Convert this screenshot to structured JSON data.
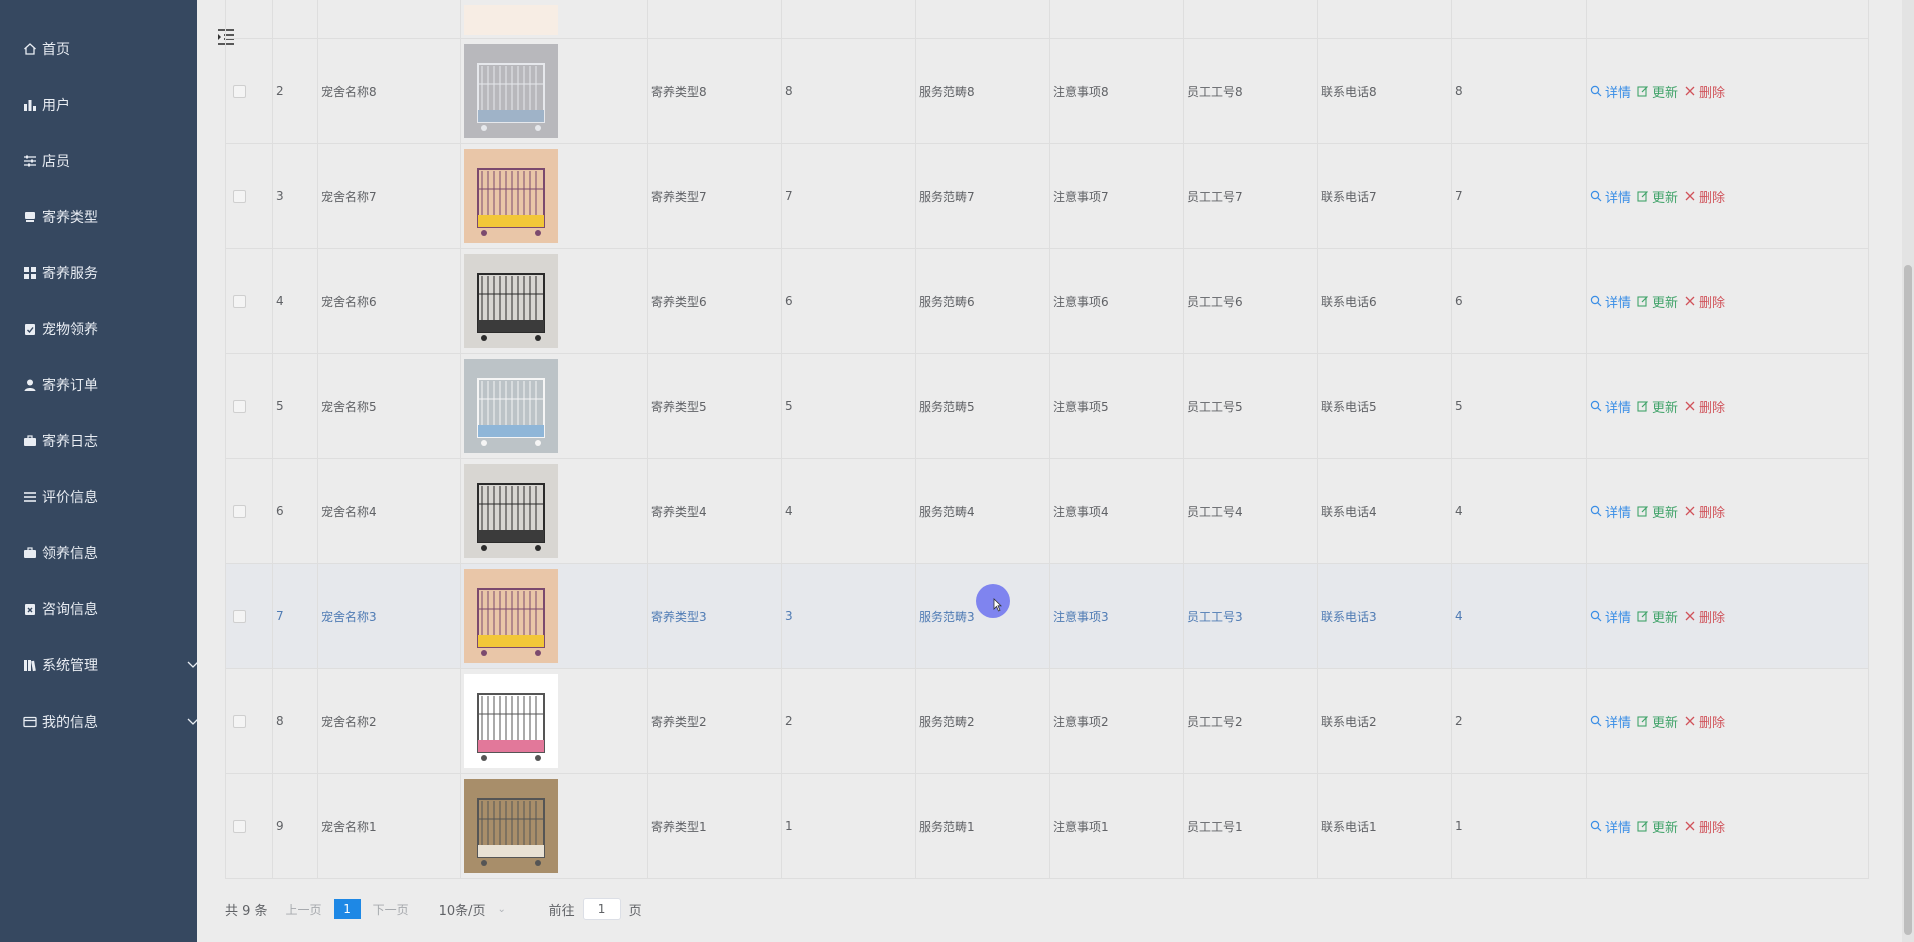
{
  "sidebar": {
    "items": [
      {
        "label": "首页",
        "icon": "home-icon"
      },
      {
        "label": "用户",
        "icon": "bar-chart-icon"
      },
      {
        "label": "店员",
        "icon": "sliders-icon"
      },
      {
        "label": "寄养类型",
        "icon": "box-icon"
      },
      {
        "label": "寄养服务",
        "icon": "grid-icon"
      },
      {
        "label": "宠物领养",
        "icon": "clipboard-check-icon"
      },
      {
        "label": "寄养订单",
        "icon": "user-icon"
      },
      {
        "label": "寄养日志",
        "icon": "briefcase-icon"
      },
      {
        "label": "评价信息",
        "icon": "list-icon"
      },
      {
        "label": "领养信息",
        "icon": "briefcase-icon"
      },
      {
        "label": "咨询信息",
        "icon": "clipboard-x-icon"
      },
      {
        "label": "系统管理",
        "icon": "library-icon",
        "expandable": true
      },
      {
        "label": "我的信息",
        "icon": "card-icon",
        "expandable": true
      }
    ]
  },
  "table": {
    "rows": [
      {
        "index": "2",
        "name": "宠舍名称8",
        "type": "寄养类型8",
        "num": "8",
        "scope": "服务范畴8",
        "notes": "注意事项8",
        "staff": "员工工号8",
        "phone": "联系电话8",
        "last": "8",
        "image": "cage-white-icon",
        "highlight": false
      },
      {
        "index": "3",
        "name": "宠舍名称7",
        "type": "寄养类型7",
        "num": "7",
        "scope": "服务范畴7",
        "notes": "注意事项7",
        "staff": "员工工号7",
        "phone": "联系电话7",
        "last": "7",
        "image": "cage-hamster-icon",
        "highlight": false
      },
      {
        "index": "4",
        "name": "宠舍名称6",
        "type": "寄养类型6",
        "num": "6",
        "scope": "服务范畴6",
        "notes": "注意事项6",
        "staff": "员工工号6",
        "phone": "联系电话6",
        "last": "6",
        "image": "cage-black-icon",
        "highlight": false
      },
      {
        "index": "5",
        "name": "宠舍名称5",
        "type": "寄养类型5",
        "num": "5",
        "scope": "服务范畴5",
        "notes": "注意事项5",
        "staff": "员工工号5",
        "phone": "联系电话5",
        "last": "5",
        "image": "cage-dog-icon",
        "highlight": false
      },
      {
        "index": "6",
        "name": "宠舍名称4",
        "type": "寄养类型4",
        "num": "4",
        "scope": "服务范畴4",
        "notes": "注意事项4",
        "staff": "员工工号4",
        "phone": "联系电话4",
        "last": "4",
        "image": "cage-black-icon",
        "highlight": false
      },
      {
        "index": "7",
        "name": "宠舍名称3",
        "type": "寄养类型3",
        "num": "3",
        "scope": "服务范畴3",
        "notes": "注意事项3",
        "staff": "员工工号3",
        "phone": "联系电话3",
        "last": "4",
        "image": "cage-hamster-icon",
        "highlight": true
      },
      {
        "index": "8",
        "name": "宠舍名称2",
        "type": "寄养类型2",
        "num": "2",
        "scope": "服务范畴2",
        "notes": "注意事项2",
        "staff": "员工工号2",
        "phone": "联系电话2",
        "last": "2",
        "image": "cage-pink-icon",
        "highlight": false
      },
      {
        "index": "9",
        "name": "宠舍名称1",
        "type": "寄养类型1",
        "num": "1",
        "scope": "服务范畴1",
        "notes": "注意事项1",
        "staff": "员工工号1",
        "phone": "联系电话1",
        "last": "1",
        "image": "cage-cabinet-icon",
        "highlight": false
      }
    ],
    "actions": {
      "detail": "详情",
      "update": "更新",
      "delete": "删除"
    }
  },
  "pagination": {
    "total": "共 9 条",
    "prev": "上一页",
    "current": "1",
    "next": "下一页",
    "page_size": "10条/页",
    "goto_label": "前往",
    "goto_value": "1",
    "page_unit": "页"
  },
  "colors": {
    "sidebar": "#364860",
    "accent": "#1e88e5",
    "detail": "#3a8ee6",
    "update": "#41a36a",
    "delete": "#d0535a"
  }
}
